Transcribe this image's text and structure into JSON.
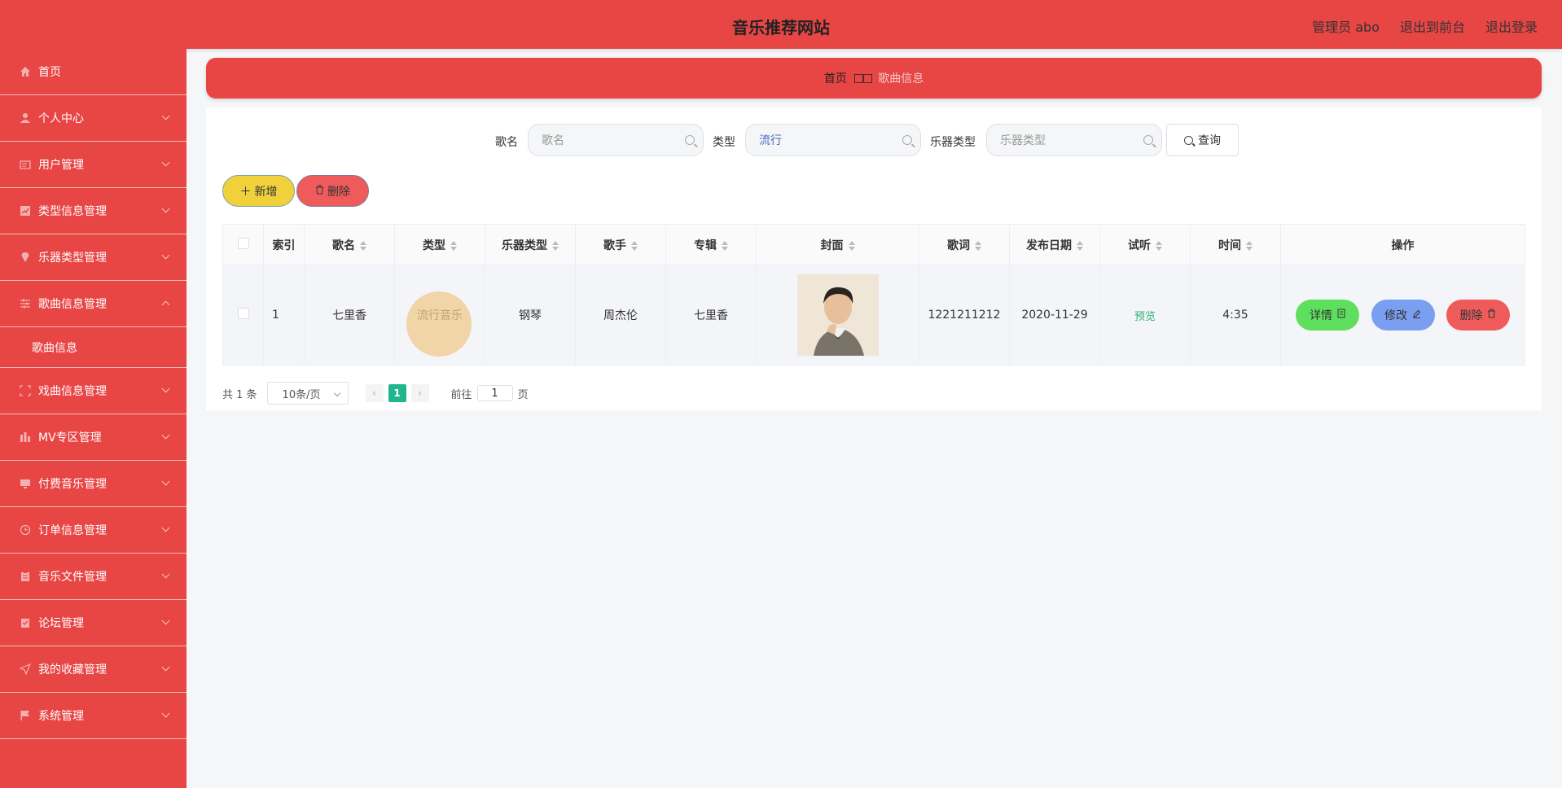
{
  "header": {
    "title": "音乐推荐网站",
    "admin": "管理员 abo",
    "back_to_front": "退出到前台",
    "logout": "退出登录"
  },
  "sidebar": {
    "items": [
      {
        "label": "首页",
        "icon": "home-icon"
      },
      {
        "label": "个人中心",
        "icon": "user-icon"
      },
      {
        "label": "用户管理",
        "icon": "id-card-icon"
      },
      {
        "label": "类型信息管理",
        "icon": "chart-icon"
      },
      {
        "label": "乐器类型管理",
        "icon": "pin-icon"
      },
      {
        "label": "歌曲信息管理",
        "icon": "sliders-icon"
      },
      {
        "label": "歌曲信息",
        "icon": ""
      },
      {
        "label": "戏曲信息管理",
        "icon": "fullscreen-icon"
      },
      {
        "label": "MV专区管理",
        "icon": "bar-chart-icon"
      },
      {
        "label": "付费音乐管理",
        "icon": "monitor-icon"
      },
      {
        "label": "订单信息管理",
        "icon": "clock-icon"
      },
      {
        "label": "音乐文件管理",
        "icon": "clipboard-icon"
      },
      {
        "label": "论坛管理",
        "icon": "tasks-icon"
      },
      {
        "label": "我的收藏管理",
        "icon": "send-icon"
      },
      {
        "label": "系统管理",
        "icon": "flag-icon"
      }
    ]
  },
  "breadcrumb": {
    "home": "首页",
    "separator": "□□",
    "current": "歌曲信息"
  },
  "search": {
    "song_label": "歌名",
    "song_placeholder": "歌名",
    "type_label": "类型",
    "type_value": "流行",
    "instrument_label": "乐器类型",
    "instrument_placeholder": "乐器类型",
    "query_button": "查询"
  },
  "actions": {
    "add": "新增",
    "delete": "删除"
  },
  "table": {
    "headers": [
      "索引",
      "歌名",
      "类型",
      "乐器类型",
      "歌手",
      "专辑",
      "封面",
      "歌词",
      "发布日期",
      "试听",
      "时间",
      "操作"
    ],
    "rows": [
      {
        "index": "1",
        "song": "七里香",
        "type": "流行音乐",
        "instrument": "钢琴",
        "singer": "周杰伦",
        "album": "七里香",
        "lyrics": "1221211212",
        "date": "2020-11-29",
        "preview": "预览",
        "duration": "4:35",
        "op_detail": "详情",
        "op_edit": "修改",
        "op_delete": "删除"
      }
    ]
  },
  "pagination": {
    "total": "共 1 条",
    "page_size": "10条/页",
    "current_page": "1",
    "goto_label": "前往",
    "goto_value": "1",
    "page_suffix": "页"
  },
  "colors": {
    "primary": "#e84545",
    "accent_green": "#1fb58f",
    "detail": "#5ee05e",
    "edit": "#7a9ef0",
    "delete": "#ef5b5b",
    "add": "#f0d13c"
  }
}
